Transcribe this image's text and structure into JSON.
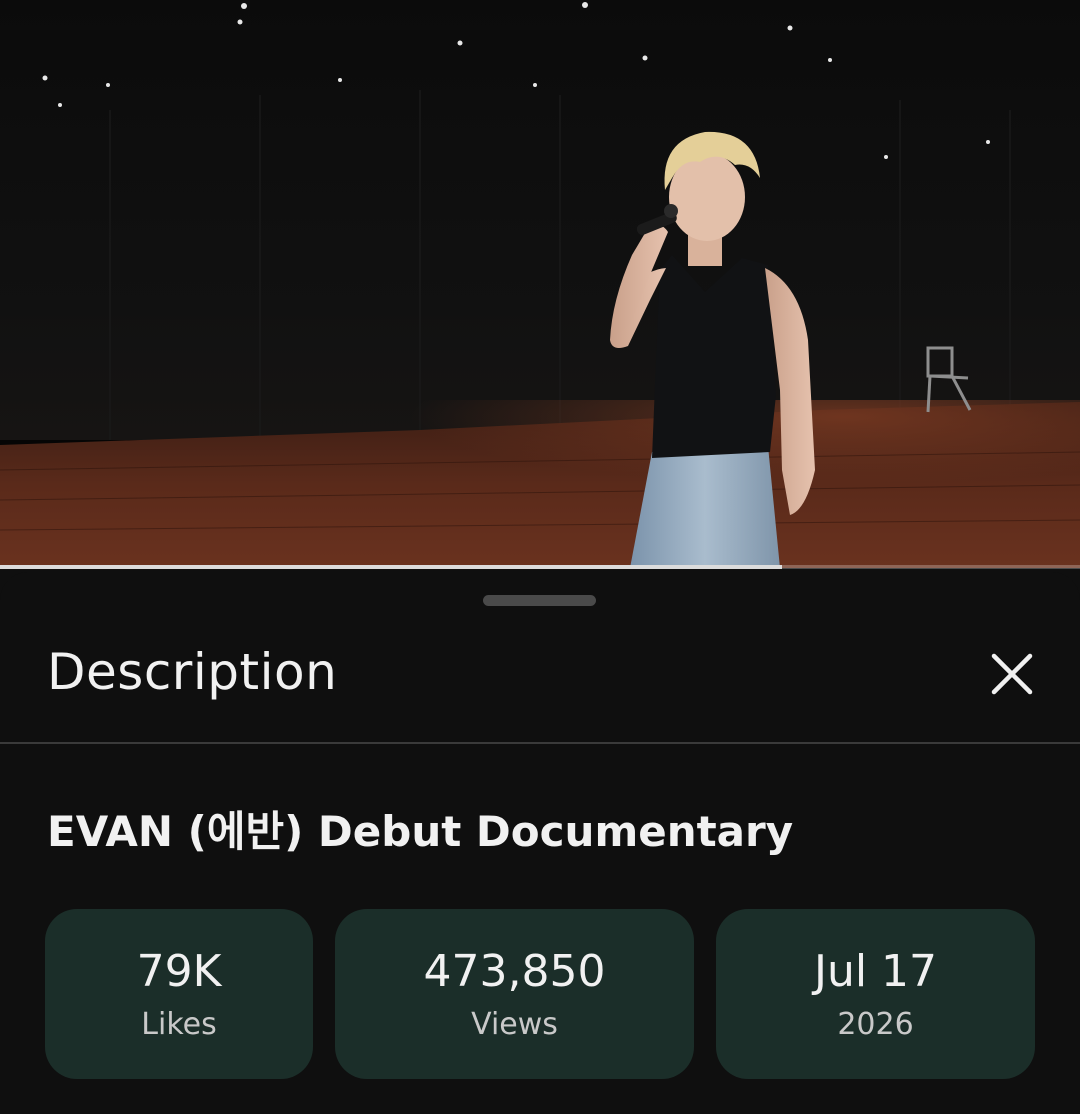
{
  "video": {
    "progress_fraction": 0.724
  },
  "sheet": {
    "title": "Description",
    "close_icon": "close-icon"
  },
  "details": {
    "video_title": "EVAN (에반) Debut Documentary",
    "stats": {
      "likes": {
        "value": "79K",
        "label": "Likes"
      },
      "views": {
        "value": "473,850",
        "label": "Views"
      },
      "date": {
        "value": "Jul 17",
        "label": "2026"
      }
    }
  },
  "colors": {
    "background": "#0f0f0f",
    "stat_card": "#1b2e29",
    "text_primary": "#f1f1f1",
    "text_secondary": "#c9c9c9",
    "progress": "#dcdcdc"
  }
}
